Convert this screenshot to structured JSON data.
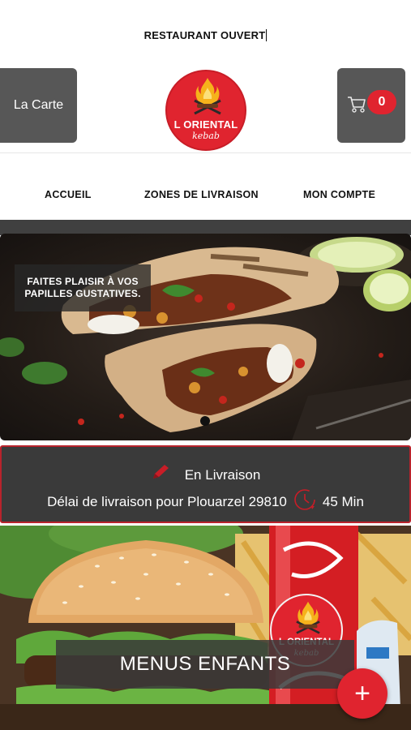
{
  "status": {
    "text": "RESTAURANT OUVERT"
  },
  "header": {
    "menu_label": "La Carte",
    "logo": {
      "line1": "L ORIENTAL",
      "line2": "kebab"
    },
    "cart": {
      "count": "0"
    }
  },
  "nav": {
    "items": [
      {
        "label": "ACCUEIL"
      },
      {
        "label": "ZONES DE LIVRAISON"
      },
      {
        "label": "MON COMPTE"
      }
    ]
  },
  "banner1": {
    "caption": "FAITES PLAISIR À VOS PAPILLES GUSTATIVES."
  },
  "delivery": {
    "mode": "En Livraison",
    "delay_label": "Délai de livraison pour Plouarzel 29810",
    "delay_value": "45 Min"
  },
  "banner2": {
    "caption": "MENUS ENFANTS",
    "logo": {
      "line1": "L ORIENTAL",
      "line2": "kebab"
    }
  },
  "fab": {
    "icon": "plus-icon",
    "label": "+"
  },
  "colors": {
    "accent": "#e0242f",
    "button_gray": "#575757",
    "panel_dark": "#3a3a3a"
  }
}
